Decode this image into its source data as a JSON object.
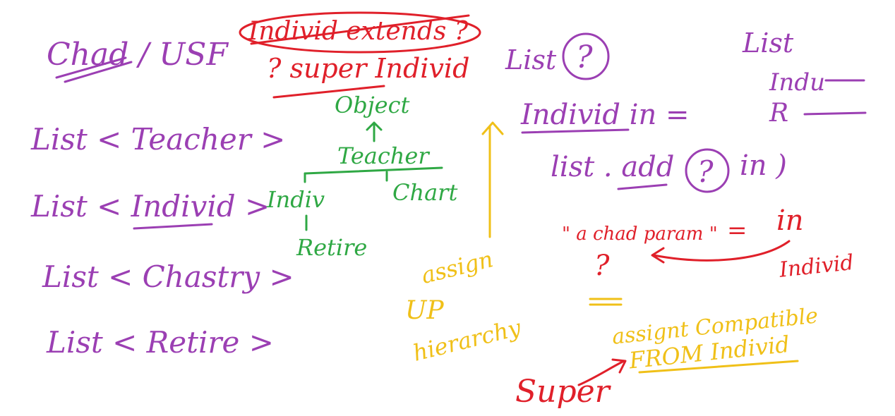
{
  "colors": {
    "purple": "#9b3fb3",
    "red": "#e0202a",
    "green": "#2fa844",
    "gold": "#f0c018",
    "background": "#ffffff"
  },
  "left": {
    "header": "Chad / USF",
    "lists": [
      "List < Teacher >",
      "List < Individ >",
      "List < Chastry >",
      "List < Retire >"
    ]
  },
  "top": {
    "crossed": "Individ extends ?",
    "super_line": "? super Individ"
  },
  "hierarchy": {
    "object": "Object",
    "teacher": "Teacher",
    "individ": "Indiv",
    "chart": "Chart",
    "retire": "Retire"
  },
  "arrow_note": {
    "line1": "assign",
    "line2": "UP",
    "line3": "hierarchy"
  },
  "right": {
    "list_q": "List",
    "list_q_mark": "?",
    "list_top": "List",
    "indu": "Indu",
    "r": "R",
    "assign_line": "Individ   in  =",
    "add_line_prefix": "list . add",
    "add_q": "?",
    "add_line_suffix": "in   )",
    "actual_param": "\" a chad param \"",
    "eq": "=",
    "in2": "in",
    "individ_red": "Individ",
    "q_red": "?",
    "assign_compat": "assignt Compatible",
    "from_individ": "FROM Individ",
    "super_red": "Super"
  }
}
